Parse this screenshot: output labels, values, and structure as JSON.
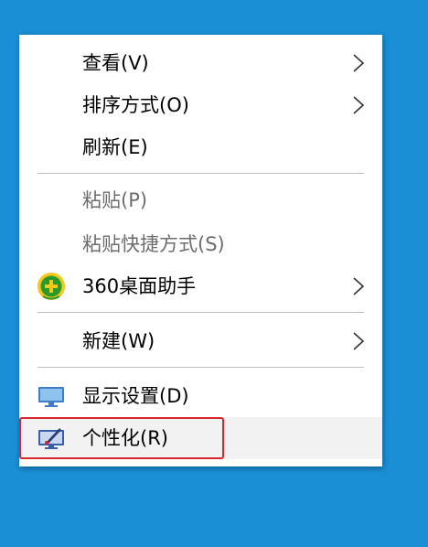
{
  "context_menu": {
    "items": [
      {
        "label": "查看(V)",
        "icon": "",
        "submenu": true,
        "disabled": false
      },
      {
        "label": "排序方式(O)",
        "icon": "",
        "submenu": true,
        "disabled": false
      },
      {
        "label": "刷新(E)",
        "icon": "",
        "submenu": false,
        "disabled": false
      },
      {
        "label": "粘贴(P)",
        "icon": "",
        "submenu": false,
        "disabled": true
      },
      {
        "label": "粘贴快捷方式(S)",
        "icon": "",
        "submenu": false,
        "disabled": true
      },
      {
        "label": "360桌面助手",
        "icon": "360-assistant-icon",
        "submenu": true,
        "disabled": false
      },
      {
        "label": "新建(W)",
        "icon": "",
        "submenu": true,
        "disabled": false
      },
      {
        "label": "显示设置(D)",
        "icon": "display-settings-icon",
        "submenu": false,
        "disabled": false
      },
      {
        "label": "个性化(R)",
        "icon": "personalize-icon",
        "submenu": false,
        "disabled": false,
        "highlighted": true
      }
    ]
  },
  "colors": {
    "desktop_background": "#1a8fd6",
    "menu_background": "#ffffff",
    "highlight_border": "#d8262e",
    "disabled_text": "#6d6d6d"
  }
}
